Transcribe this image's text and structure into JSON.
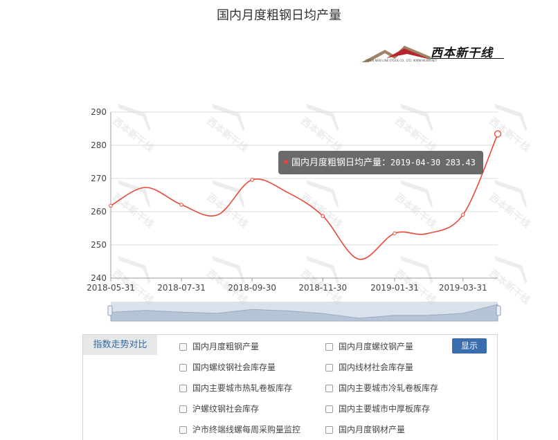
{
  "title": "国内月度粗钢日均产量",
  "logo": {
    "text": "西本新干线",
    "subtext": "XIBEN NEW LINE STOCK CO., LTD.  WWW.96369.NET"
  },
  "watermark_text": "西本新干线",
  "tooltip": {
    "series": "国内月度粗钢日均产量：",
    "value": "2019-04-30 283.43"
  },
  "colors": {
    "line": "#e8473a",
    "navigator_fill": "#c9d4e3",
    "button": "#3a6db0"
  },
  "chart_data": {
    "type": "line",
    "title": "国内月度粗钢日均产量",
    "x_tick_labels": [
      "2018-05-31",
      "2018-07-31",
      "2018-09-30",
      "2018-11-30",
      "2019-01-31",
      "2019-03-31"
    ],
    "y_tick_labels": [
      "240",
      "250",
      "260",
      "270",
      "280",
      "290"
    ],
    "ylim": [
      240,
      290
    ],
    "grid": true,
    "series": [
      {
        "name": "国内月度粗钢日均产量",
        "points": [
          {
            "x": "2018-05-31",
            "y": 261.8
          },
          {
            "x": "2018-06-30",
            "y": 267.3
          },
          {
            "x": "2018-07-31",
            "y": 262.1
          },
          {
            "x": "2018-08-31",
            "y": 259.0
          },
          {
            "x": "2018-09-30",
            "y": 269.6
          },
          {
            "x": "2018-10-31",
            "y": 265.7
          },
          {
            "x": "2018-11-30",
            "y": 258.7
          },
          {
            "x": "2018-12-31",
            "y": 245.7
          },
          {
            "x": "2019-01-31",
            "y": 253.5
          },
          {
            "x": "2019-02-28",
            "y": 253.4
          },
          {
            "x": "2019-03-31",
            "y": 259.1
          },
          {
            "x": "2019-04-30",
            "y": 283.43
          }
        ]
      }
    ]
  },
  "compare": {
    "label": "指数走势对比",
    "button": "显示",
    "options": [
      "国内月度粗钢产量",
      "国内月度螺纹钢产量",
      "国内螺纹钢社会库存量",
      "国内线材社会库存量",
      "国内主要城市热轧卷板库存",
      "国内主要城市冷轧卷板库存",
      "沪螺纹钢社会库存",
      "国内主要城市中厚板库存",
      "沪市终端线螺每周采购量监控",
      "国内月度钢材产量"
    ]
  }
}
